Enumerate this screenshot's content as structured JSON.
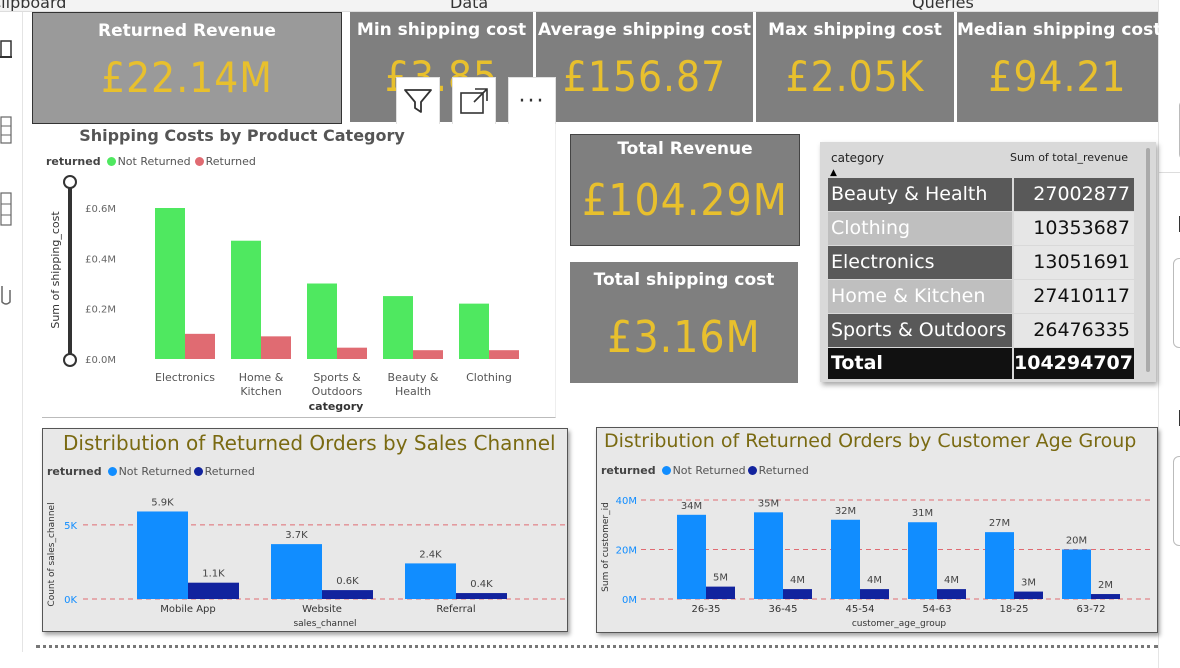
{
  "ribbon": {
    "clipboard": "Clipboard",
    "data": "Data",
    "queries": "Queries"
  },
  "kpis": [
    {
      "title": "Returned Revenue",
      "value": "£22.14M"
    },
    {
      "title": "Min shipping cost",
      "value": "£3.85"
    },
    {
      "title": "Average shipping cost",
      "value": "£156.87"
    },
    {
      "title": "Max shipping cost",
      "value": "£2.05K"
    },
    {
      "title": "Median shipping cost",
      "value": "£94.21"
    }
  ],
  "visual_toolbar": {
    "filter": "filter-icon",
    "focus": "focus-mode-icon",
    "more": "more-options-icon",
    "more_glyph": "···"
  },
  "total_revenue": {
    "title": "Total Revenue",
    "value": "£104.29M"
  },
  "total_shipping": {
    "title": "Total shipping cost",
    "value": "£3.16M"
  },
  "table": {
    "headers": [
      "category",
      "Sum of total_revenue"
    ],
    "rows": [
      {
        "category": "Beauty & Health",
        "value": "27002877"
      },
      {
        "category": "Clothing",
        "value": "10353687"
      },
      {
        "category": "Electronics",
        "value": "13051691"
      },
      {
        "category": "Home & Kitchen",
        "value": "27410117"
      },
      {
        "category": "Sports & Outdoors",
        "value": "26476335"
      }
    ],
    "total": {
      "label": "Total",
      "value": "104294707"
    }
  },
  "chart_data": [
    {
      "type": "bar",
      "title": "Shipping Costs by Product Category",
      "legend_title": "returned",
      "legend_position": "top-left",
      "xlabel": "category",
      "ylabel": "Sum of shipping_cost",
      "categories": [
        "Electronics",
        "Home & Kitchen",
        "Sports & Outdoors",
        "Beauty & Health",
        "Clothing"
      ],
      "category_lines": [
        [
          "Electronics"
        ],
        [
          "Home &",
          "Kitchen"
        ],
        [
          "Sports &",
          "Outdoors"
        ],
        [
          "Beauty &",
          "Health"
        ],
        [
          "Clothing"
        ]
      ],
      "series": [
        {
          "name": "Not Returned",
          "color": "#4fe860",
          "values": [
            0.6,
            0.47,
            0.3,
            0.25,
            0.22
          ]
        },
        {
          "name": "Returned",
          "color": "#e06b72",
          "values": [
            0.1,
            0.09,
            0.045,
            0.035,
            0.035
          ]
        }
      ],
      "yticks": [
        "£0.0M",
        "£0.2M",
        "£0.4M",
        "£0.6M"
      ],
      "ytick_values": [
        0,
        0.2,
        0.4,
        0.6
      ],
      "ylim": [
        0,
        0.6
      ],
      "grid": false
    },
    {
      "type": "bar",
      "title": "Distribution of Returned Orders by Sales Channel",
      "legend_title": "returned",
      "legend_position": "top-left",
      "xlabel": "sales_channel",
      "ylabel": "Count of sales_channel",
      "categories": [
        "Mobile App",
        "Website",
        "Referral"
      ],
      "series": [
        {
          "name": "Not Returned",
          "color": "#118dff",
          "values": [
            5.9,
            3.7,
            2.4
          ],
          "labels": [
            "5.9K",
            "3.7K",
            "2.4K"
          ]
        },
        {
          "name": "Returned",
          "color": "#12239e",
          "values": [
            1.1,
            0.6,
            0.4
          ],
          "labels": [
            "1.1K",
            "0.6K",
            "0.4K"
          ]
        }
      ],
      "yticks": [
        "0K",
        "5K"
      ],
      "ytick_values": [
        0,
        5
      ],
      "ylim": [
        0,
        6
      ],
      "grid": true
    },
    {
      "type": "bar",
      "title": "Distribution of Returned Orders by Customer Age Group",
      "legend_title": "returned",
      "legend_position": "top-left",
      "xlabel": "customer_age_group",
      "ylabel": "Sum of customer_id",
      "categories": [
        "26-35",
        "36-45",
        "45-54",
        "54-63",
        "18-25",
        "63-72"
      ],
      "series": [
        {
          "name": "Not Returned",
          "color": "#118dff",
          "values": [
            34,
            35,
            32,
            31,
            27,
            20
          ],
          "labels": [
            "34M",
            "35M",
            "32M",
            "31M",
            "27M",
            "20M"
          ]
        },
        {
          "name": "Returned",
          "color": "#12239e",
          "values": [
            5,
            4,
            4,
            4,
            3,
            2
          ],
          "labels": [
            "5M",
            "4M",
            "4M",
            "4M",
            "3M",
            "2M"
          ]
        }
      ],
      "yticks": [
        "0M",
        "20M",
        "40M"
      ],
      "ytick_values": [
        0,
        20,
        40
      ],
      "ylim": [
        0,
        42
      ],
      "grid": true
    }
  ]
}
